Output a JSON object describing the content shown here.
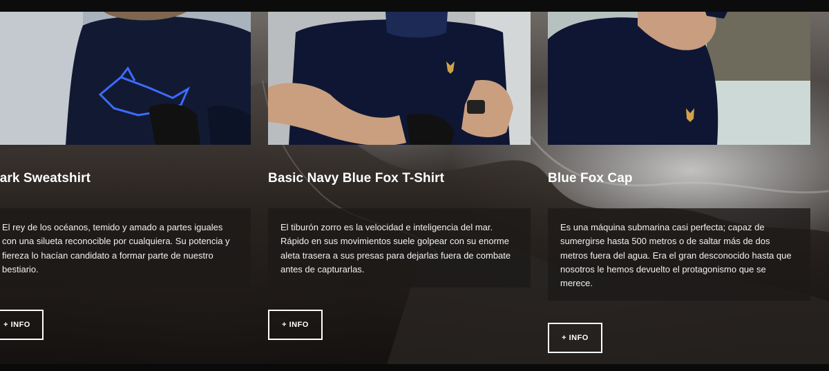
{
  "cards": [
    {
      "title": "hark Sweatshirt",
      "description": "El rey de los océanos, temido y amado a partes iguales con una silueta reconocible por cualquiera. Su potencia y fiereza lo hacían candidato a formar parte de nuestro bestiario.",
      "button_label": "+ INFO"
    },
    {
      "title": "Basic Navy Blue Fox T-Shirt",
      "description": "El tiburón zorro es la velocidad e inteligencia del mar. Rápido en sus movimientos suele golpear con su enorme aleta trasera a sus presas para dejarlas fuera de combate antes de capturarlas.",
      "button_label": "+ INFO"
    },
    {
      "title": "Blue Fox Cap",
      "description": "Es una máquina submarina casi perfecta; capaz de sumergirse hasta 500 metros o de saltar más de dos metros fuera del agua. Era el gran desconocido hasta que nosotros le hemos devuelto el protagonismo que se merece.",
      "button_label": "+ INFO"
    }
  ],
  "colors": {
    "navy": "#0f1633",
    "fox_logo": "#d1a14a",
    "shark_print": "#3d6bff"
  },
  "icons": [
    "shark-logo-icon",
    "fox-logo-icon"
  ]
}
